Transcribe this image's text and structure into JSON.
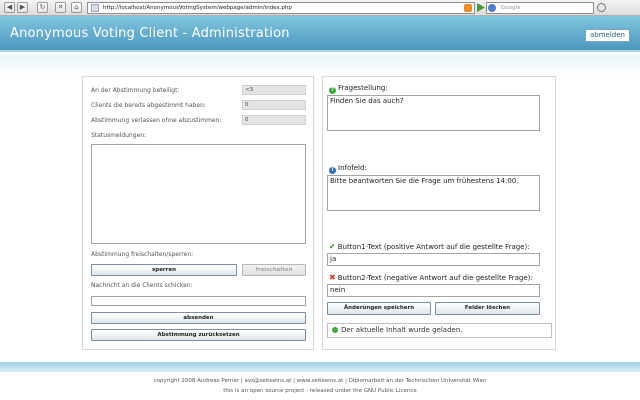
{
  "browser": {
    "url": "http://localhost/AnonymousVotingSystem/webpage/admin/index.php",
    "search_placeholder": "Google"
  },
  "header": {
    "title": "Anonymous Voting Client - Administration",
    "logout_label": "abmelden"
  },
  "stats": {
    "participants_label": "An der Abstimmung beteiligt:",
    "participants_value": "<3",
    "voted_label": "Clients die bereits abgestimmt haben:",
    "voted_value": "0",
    "left_label": "Abstimmung verlassen ohne abzustimmen:",
    "left_value": "0"
  },
  "status": {
    "label": "Statusmeldungen:"
  },
  "release": {
    "label": "Abstimmung freischalten/sperren:",
    "lock_label": "sperren",
    "unlock_label": "freischalten"
  },
  "message": {
    "label": "Nachricht an die Clients schicken:",
    "send_label": "absenden",
    "reset_label": "Abstimmung zurücksetzen"
  },
  "question": {
    "label": "Fragestellung:",
    "value": "Finden Sie das auch?"
  },
  "info": {
    "label": "Infofeld:",
    "value": "Bitte beantworten Sie die Frage um frühestens 14:00."
  },
  "button1": {
    "label": "Button1-Text (positive Antwort auf die gestellte Frage):",
    "value": "ja"
  },
  "button2": {
    "label": "Button2-Text (negative Antwort auf die gestellte Frage):",
    "value": "nein"
  },
  "actions": {
    "save_label": "Änderungen speichern",
    "clear_label": "Felder löschen"
  },
  "status_line": {
    "text": "Der aktuelle Inhalt wurde geladen."
  },
  "footer": {
    "line1": "copyright 2008 Andreas Perner | avs@seiteeins.at | www.seiteeins.at | Diplomarbeit an der Technischen Universität Wien",
    "line2": "this is an open source project - released under the GNU Public Licence"
  },
  "colors": {
    "header_accent": "#5ea9cc",
    "status_ok": "#3aa83a"
  }
}
